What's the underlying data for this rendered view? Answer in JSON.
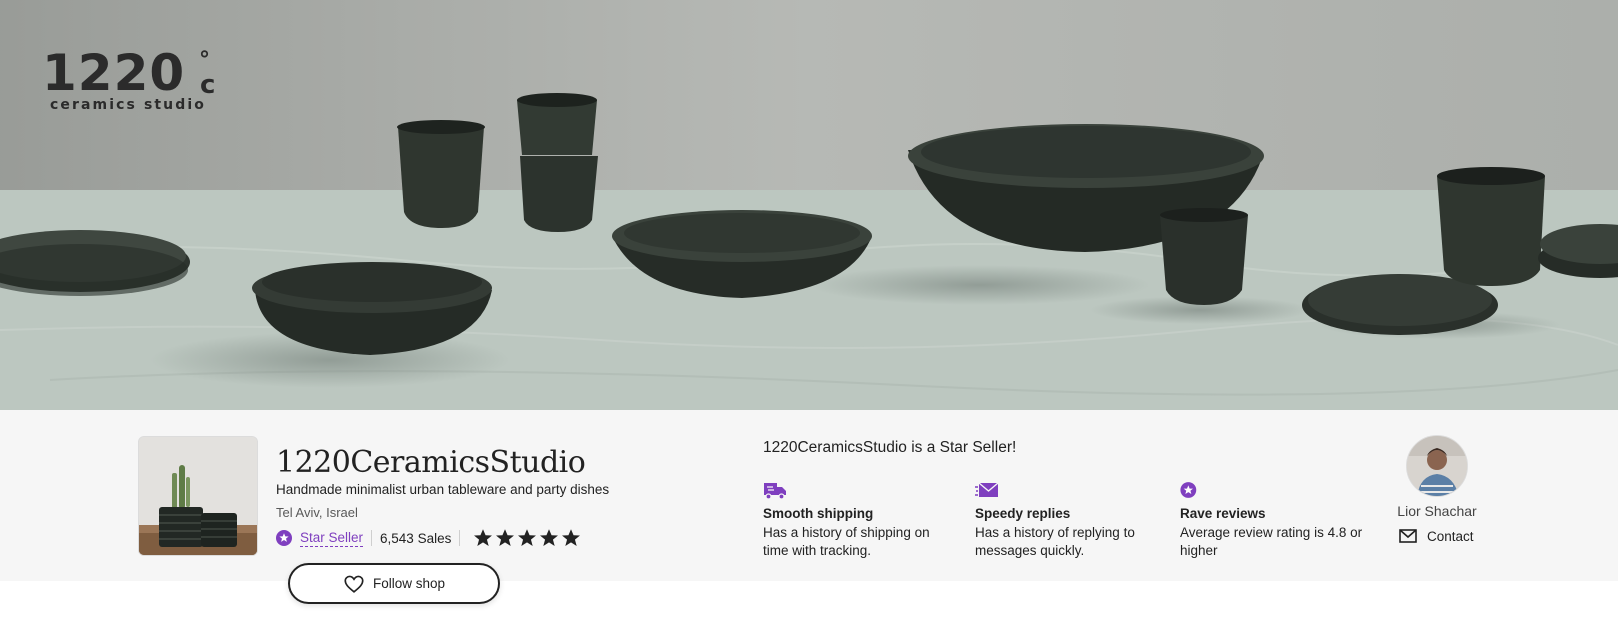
{
  "banner": {
    "logo_main": "1220",
    "logo_degree": "°",
    "logo_c": "c",
    "logo_sub": "ceramics studio"
  },
  "shop": {
    "name": "1220CeramicsStudio",
    "tagline": "Handmade minimalist urban tableware and party dishes",
    "location": "Tel Aviv, Israel",
    "star_seller_label": "Star Seller",
    "sales": "6,543 Sales",
    "rating_stars": 5,
    "follow_label": "Follow shop"
  },
  "star_seller": {
    "title": "1220CeramicsStudio is a Star Seller!",
    "perks": [
      {
        "title": "Smooth shipping",
        "desc": "Has a history of shipping on time with tracking.",
        "icon": "truck-icon"
      },
      {
        "title": "Speedy replies",
        "desc": "Has a history of replying to messages quickly.",
        "icon": "envelope-speed-icon"
      },
      {
        "title": "Rave reviews",
        "desc": "Average review rating is 4.8 or higher",
        "icon": "star-badge-icon"
      }
    ]
  },
  "owner": {
    "name": "Lior Shachar",
    "contact_label": "Contact"
  },
  "colors": {
    "accent_purple": "#7f3fbf",
    "text": "#222222",
    "strip_bg": "#f6f6f6"
  }
}
